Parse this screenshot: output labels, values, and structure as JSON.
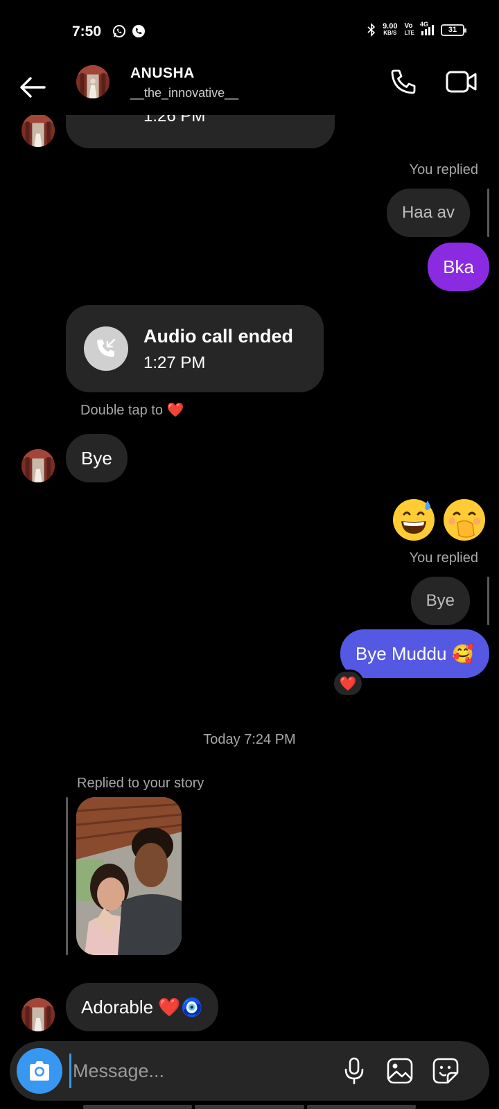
{
  "status_bar": {
    "time": "7:50",
    "net_speed_value": "9.00",
    "net_speed_unit": "KB/S",
    "volte_top": "Vo",
    "volte_bottom": "LTE",
    "network": "4G",
    "battery": "31"
  },
  "header": {
    "name": "ANUSHA",
    "username": "__the_innovative__"
  },
  "messages": {
    "partial_call_time": "1:26 PM",
    "reply1_label": "You replied",
    "reply1_quote": "Haa av",
    "sent1": "Bka",
    "call_title": "Audio call ended",
    "call_time": "1:27 PM",
    "double_tap_hint": "Double tap to",
    "double_tap_emoji": "❤️",
    "in_bye": "Bye",
    "reply2_label": "You replied",
    "reply2_quote": "Bye",
    "sent2": "Bye Muddu 🥰",
    "sent2_reaction": "❤️",
    "timestamp": "Today 7:24 PM",
    "story_label": "Replied to your story",
    "in_last": "Adorable ❤️🧿"
  },
  "composer": {
    "placeholder": "Message..."
  },
  "colors": {
    "background": "#000000",
    "incoming_bubble": "#262626",
    "sent_purple": "#8a2be2",
    "sent_blue": "#5458e2",
    "camera_button": "#3897f0"
  }
}
